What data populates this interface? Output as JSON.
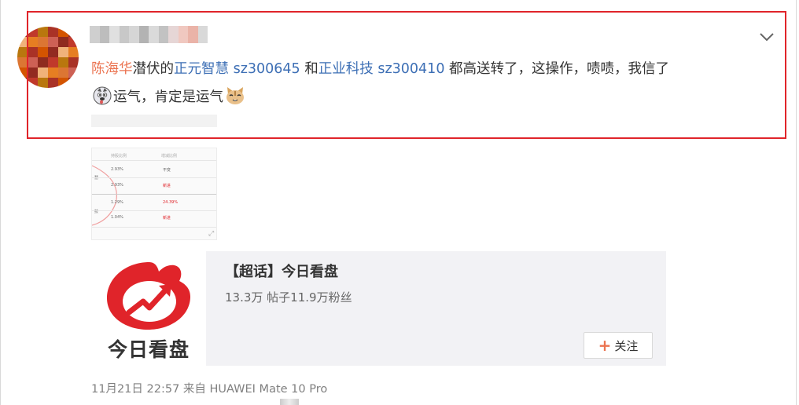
{
  "post": {
    "text_parts": {
      "mention": "陈海华",
      "t1": "潜伏的",
      "company1": "正元智慧",
      "stock1": "sz300645",
      "t2": " 和",
      "company2": "正业科技",
      "stock2": "sz300410",
      "t3": " 都高送转了，这操作，啧啧，我信了",
      "t4": "运气，肯定是运气"
    },
    "emojis": [
      "doge-emoji-icon",
      "cat-emoji-icon"
    ]
  },
  "thumbnail": {
    "headers": [
      "持股比例",
      "增减比例"
    ],
    "side_labels": [
      "慧",
      "技"
    ],
    "rows": [
      {
        "pct": "2.93%",
        "change": "不变",
        "red": false
      },
      {
        "pct": "2.93%",
        "change": "新进",
        "red": true
      },
      {
        "pct": "1.29%",
        "change": "24.39%",
        "red": true
      },
      {
        "pct": "1.04%",
        "change": "新进",
        "red": true
      }
    ]
  },
  "card": {
    "title": "【超话】今日看盘",
    "stats": "13.3万 帖子11.9万粉丝",
    "logo_text": "今日看盘",
    "follow_label": "关注"
  },
  "meta": {
    "time": "11月21日 22:57",
    "source_prefix": "来自",
    "source": "HUAWEI Mate 10 Pro"
  },
  "colors": {
    "highlight_border": "#e0242a",
    "link_orange": "#eb7350",
    "link_blue": "#3d6fb5",
    "weibo_red": "#e0242a"
  }
}
